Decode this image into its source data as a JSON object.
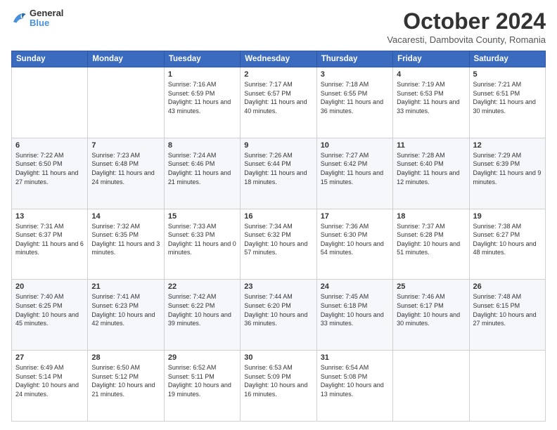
{
  "logo": {
    "general": "General",
    "blue": "Blue"
  },
  "header": {
    "month": "October 2024",
    "location": "Vacaresti, Dambovita County, Romania"
  },
  "weekdays": [
    "Sunday",
    "Monday",
    "Tuesday",
    "Wednesday",
    "Thursday",
    "Friday",
    "Saturday"
  ],
  "weeks": [
    [
      {
        "day": "",
        "sunrise": "",
        "sunset": "",
        "daylight": ""
      },
      {
        "day": "",
        "sunrise": "",
        "sunset": "",
        "daylight": ""
      },
      {
        "day": "1",
        "sunrise": "Sunrise: 7:16 AM",
        "sunset": "Sunset: 6:59 PM",
        "daylight": "Daylight: 11 hours and 43 minutes."
      },
      {
        "day": "2",
        "sunrise": "Sunrise: 7:17 AM",
        "sunset": "Sunset: 6:57 PM",
        "daylight": "Daylight: 11 hours and 40 minutes."
      },
      {
        "day": "3",
        "sunrise": "Sunrise: 7:18 AM",
        "sunset": "Sunset: 6:55 PM",
        "daylight": "Daylight: 11 hours and 36 minutes."
      },
      {
        "day": "4",
        "sunrise": "Sunrise: 7:19 AM",
        "sunset": "Sunset: 6:53 PM",
        "daylight": "Daylight: 11 hours and 33 minutes."
      },
      {
        "day": "5",
        "sunrise": "Sunrise: 7:21 AM",
        "sunset": "Sunset: 6:51 PM",
        "daylight": "Daylight: 11 hours and 30 minutes."
      }
    ],
    [
      {
        "day": "6",
        "sunrise": "Sunrise: 7:22 AM",
        "sunset": "Sunset: 6:50 PM",
        "daylight": "Daylight: 11 hours and 27 minutes."
      },
      {
        "day": "7",
        "sunrise": "Sunrise: 7:23 AM",
        "sunset": "Sunset: 6:48 PM",
        "daylight": "Daylight: 11 hours and 24 minutes."
      },
      {
        "day": "8",
        "sunrise": "Sunrise: 7:24 AM",
        "sunset": "Sunset: 6:46 PM",
        "daylight": "Daylight: 11 hours and 21 minutes."
      },
      {
        "day": "9",
        "sunrise": "Sunrise: 7:26 AM",
        "sunset": "Sunset: 6:44 PM",
        "daylight": "Daylight: 11 hours and 18 minutes."
      },
      {
        "day": "10",
        "sunrise": "Sunrise: 7:27 AM",
        "sunset": "Sunset: 6:42 PM",
        "daylight": "Daylight: 11 hours and 15 minutes."
      },
      {
        "day": "11",
        "sunrise": "Sunrise: 7:28 AM",
        "sunset": "Sunset: 6:40 PM",
        "daylight": "Daylight: 11 hours and 12 minutes."
      },
      {
        "day": "12",
        "sunrise": "Sunrise: 7:29 AM",
        "sunset": "Sunset: 6:39 PM",
        "daylight": "Daylight: 11 hours and 9 minutes."
      }
    ],
    [
      {
        "day": "13",
        "sunrise": "Sunrise: 7:31 AM",
        "sunset": "Sunset: 6:37 PM",
        "daylight": "Daylight: 11 hours and 6 minutes."
      },
      {
        "day": "14",
        "sunrise": "Sunrise: 7:32 AM",
        "sunset": "Sunset: 6:35 PM",
        "daylight": "Daylight: 11 hours and 3 minutes."
      },
      {
        "day": "15",
        "sunrise": "Sunrise: 7:33 AM",
        "sunset": "Sunset: 6:33 PM",
        "daylight": "Daylight: 11 hours and 0 minutes."
      },
      {
        "day": "16",
        "sunrise": "Sunrise: 7:34 AM",
        "sunset": "Sunset: 6:32 PM",
        "daylight": "Daylight: 10 hours and 57 minutes."
      },
      {
        "day": "17",
        "sunrise": "Sunrise: 7:36 AM",
        "sunset": "Sunset: 6:30 PM",
        "daylight": "Daylight: 10 hours and 54 minutes."
      },
      {
        "day": "18",
        "sunrise": "Sunrise: 7:37 AM",
        "sunset": "Sunset: 6:28 PM",
        "daylight": "Daylight: 10 hours and 51 minutes."
      },
      {
        "day": "19",
        "sunrise": "Sunrise: 7:38 AM",
        "sunset": "Sunset: 6:27 PM",
        "daylight": "Daylight: 10 hours and 48 minutes."
      }
    ],
    [
      {
        "day": "20",
        "sunrise": "Sunrise: 7:40 AM",
        "sunset": "Sunset: 6:25 PM",
        "daylight": "Daylight: 10 hours and 45 minutes."
      },
      {
        "day": "21",
        "sunrise": "Sunrise: 7:41 AM",
        "sunset": "Sunset: 6:23 PM",
        "daylight": "Daylight: 10 hours and 42 minutes."
      },
      {
        "day": "22",
        "sunrise": "Sunrise: 7:42 AM",
        "sunset": "Sunset: 6:22 PM",
        "daylight": "Daylight: 10 hours and 39 minutes."
      },
      {
        "day": "23",
        "sunrise": "Sunrise: 7:44 AM",
        "sunset": "Sunset: 6:20 PM",
        "daylight": "Daylight: 10 hours and 36 minutes."
      },
      {
        "day": "24",
        "sunrise": "Sunrise: 7:45 AM",
        "sunset": "Sunset: 6:18 PM",
        "daylight": "Daylight: 10 hours and 33 minutes."
      },
      {
        "day": "25",
        "sunrise": "Sunrise: 7:46 AM",
        "sunset": "Sunset: 6:17 PM",
        "daylight": "Daylight: 10 hours and 30 minutes."
      },
      {
        "day": "26",
        "sunrise": "Sunrise: 7:48 AM",
        "sunset": "Sunset: 6:15 PM",
        "daylight": "Daylight: 10 hours and 27 minutes."
      }
    ],
    [
      {
        "day": "27",
        "sunrise": "Sunrise: 6:49 AM",
        "sunset": "Sunset: 5:14 PM",
        "daylight": "Daylight: 10 hours and 24 minutes."
      },
      {
        "day": "28",
        "sunrise": "Sunrise: 6:50 AM",
        "sunset": "Sunset: 5:12 PM",
        "daylight": "Daylight: 10 hours and 21 minutes."
      },
      {
        "day": "29",
        "sunrise": "Sunrise: 6:52 AM",
        "sunset": "Sunset: 5:11 PM",
        "daylight": "Daylight: 10 hours and 19 minutes."
      },
      {
        "day": "30",
        "sunrise": "Sunrise: 6:53 AM",
        "sunset": "Sunset: 5:09 PM",
        "daylight": "Daylight: 10 hours and 16 minutes."
      },
      {
        "day": "31",
        "sunrise": "Sunrise: 6:54 AM",
        "sunset": "Sunset: 5:08 PM",
        "daylight": "Daylight: 10 hours and 13 minutes."
      },
      {
        "day": "",
        "sunrise": "",
        "sunset": "",
        "daylight": ""
      },
      {
        "day": "",
        "sunrise": "",
        "sunset": "",
        "daylight": ""
      }
    ]
  ]
}
